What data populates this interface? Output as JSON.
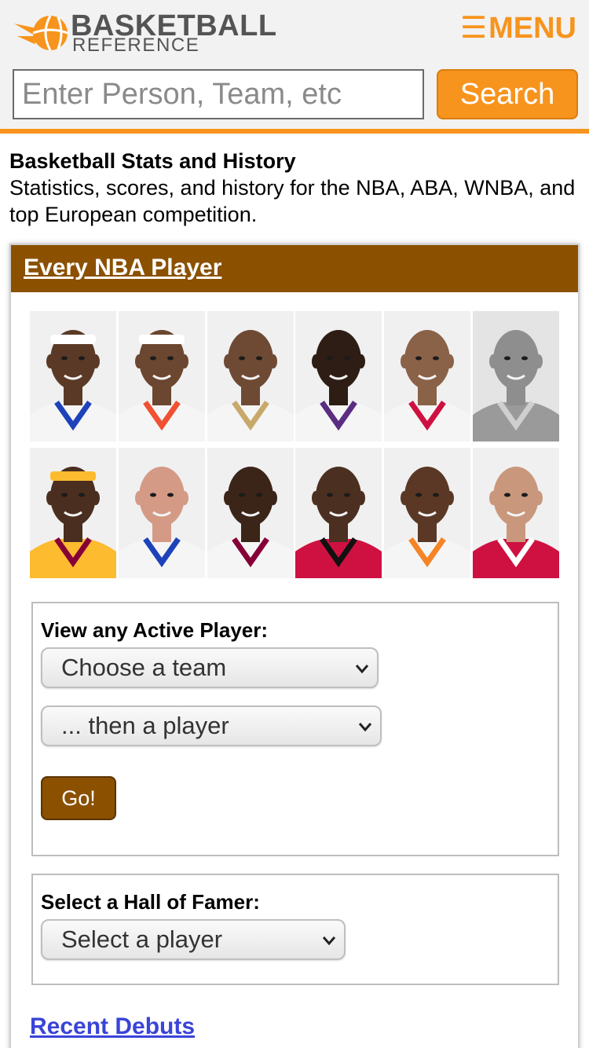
{
  "header": {
    "logo_top": "BASKETBALL",
    "logo_bottom": "REFERENCE",
    "menu_icon": "☰",
    "menu_label": "MENU",
    "search_placeholder": "Enter Person, Team, etc",
    "search_button": "Search"
  },
  "intro": {
    "title": "Basketball Stats and History",
    "description": "Statistics, scores, and history for the NBA, ABA, WNBA, and top European competition."
  },
  "card": {
    "title": "Every NBA Player",
    "player_photos": [
      {
        "icon": "player-headshot-icon",
        "jersey": "#f5f5f5",
        "trim": "#1d42ba",
        "skin": "#5a3a26",
        "band": "#ffffff"
      },
      {
        "icon": "player-headshot-icon",
        "jersey": "#f5f5f5",
        "trim": "#f05133",
        "skin": "#6b4630",
        "band": "#ffffff"
      },
      {
        "icon": "player-headshot-icon",
        "jersey": "#f5f5f5",
        "trim": "#c8a96b",
        "skin": "#6e4a35",
        "band": ""
      },
      {
        "icon": "player-headshot-icon",
        "jersey": "#f5f5f5",
        "trim": "#5a2d81",
        "skin": "#2e1d14",
        "band": ""
      },
      {
        "icon": "player-headshot-icon",
        "jersey": "#f5f5f5",
        "trim": "#ce1141",
        "skin": "#8a6248",
        "band": ""
      },
      {
        "icon": "player-headshot-icon",
        "jersey": "#9a9a9a",
        "trim": "#cfcfcf",
        "skin": "#8e8e8e",
        "band": "",
        "grayscale": true
      },
      {
        "icon": "player-headshot-icon",
        "jersey": "#fdbb30",
        "trim": "#860038",
        "skin": "#4a2e1f",
        "band": "#fdbb30"
      },
      {
        "icon": "player-headshot-icon",
        "jersey": "#f5f5f5",
        "trim": "#1d42ba",
        "skin": "#d49a86",
        "band": ""
      },
      {
        "icon": "player-headshot-icon",
        "jersey": "#f5f5f5",
        "trim": "#860038",
        "skin": "#3b2418",
        "band": ""
      },
      {
        "icon": "player-headshot-icon",
        "jersey": "#ce1141",
        "trim": "#111111",
        "skin": "#4b2f20",
        "band": ""
      },
      {
        "icon": "player-headshot-icon",
        "jersey": "#f5f5f5",
        "trim": "#f58426",
        "skin": "#5a3825",
        "band": ""
      },
      {
        "icon": "player-headshot-icon",
        "jersey": "#ce1141",
        "trim": "#ffffff",
        "skin": "#c9977c",
        "band": ""
      }
    ],
    "active_player": {
      "label": "View any Active Player:",
      "team_select": "Choose a team",
      "player_select": "... then a player",
      "go_button": "Go!"
    },
    "hall_of_fame": {
      "label": "Select a Hall of Famer:",
      "player_select": "Select a player"
    },
    "recent_debuts_link": "Recent Debuts"
  },
  "colors": {
    "accent_orange": "#f7941d",
    "card_header_brown": "#8b5000",
    "link_blue": "#3a44d8"
  }
}
